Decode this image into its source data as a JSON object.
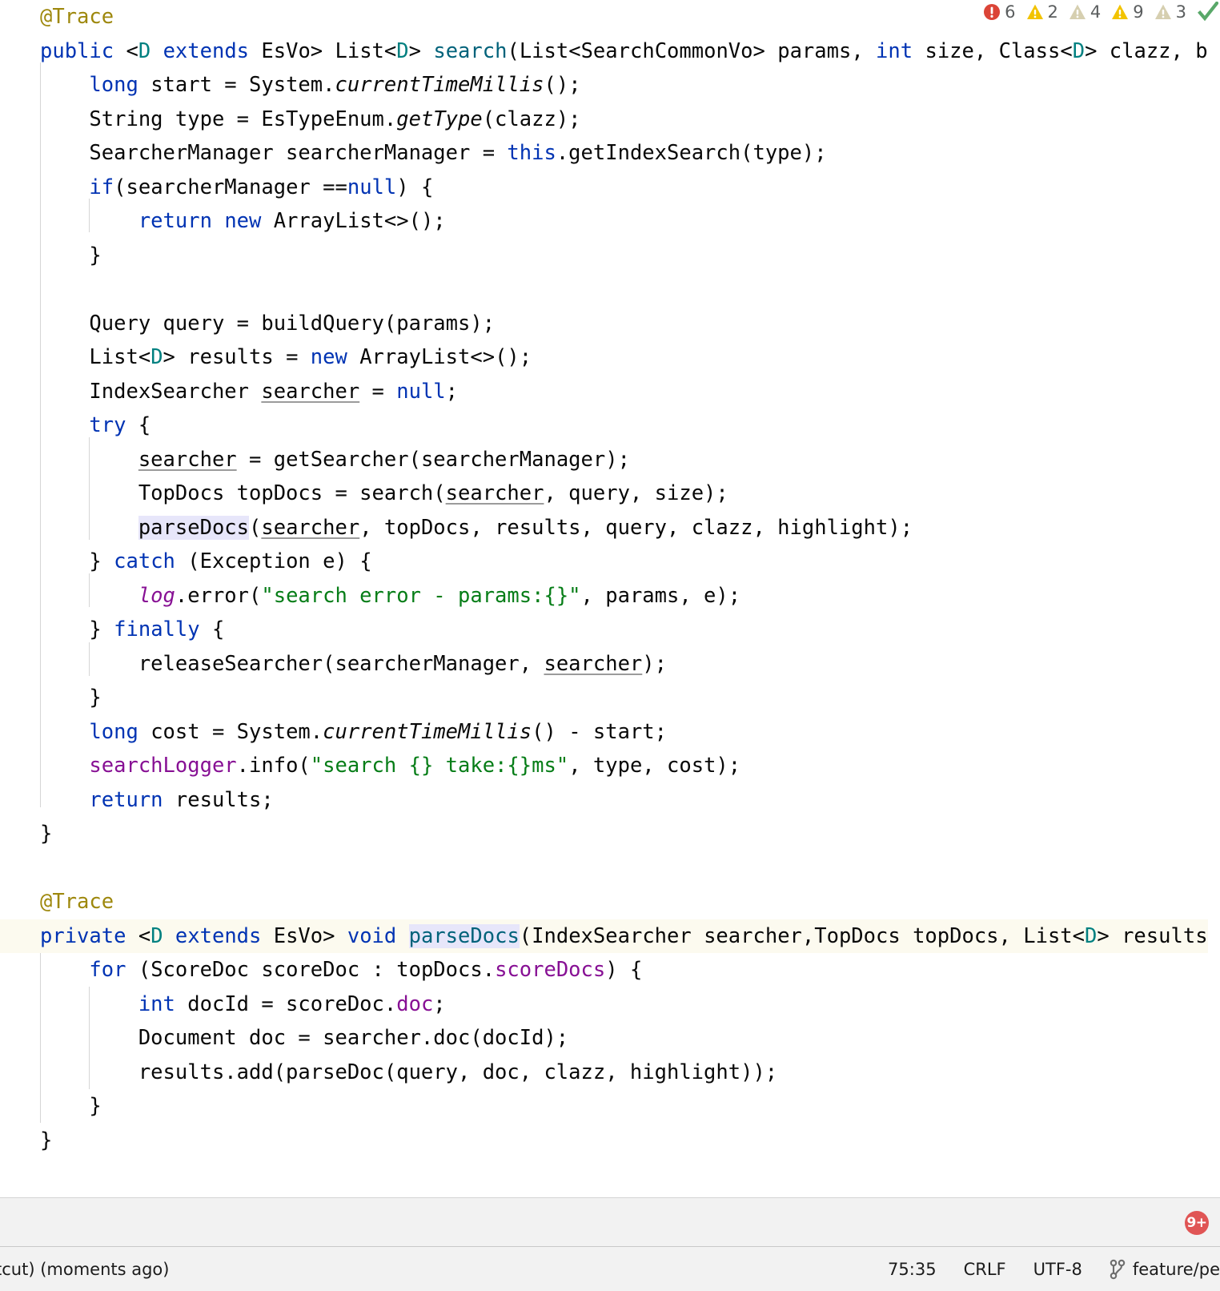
{
  "app": {
    "kind": "java-code-editor"
  },
  "inspection_widget": {
    "items": [
      {
        "icon": "error-icon",
        "count": "6",
        "severity": "error"
      },
      {
        "icon": "warning-icon",
        "count": "2",
        "severity": "warning"
      },
      {
        "icon": "weak-warning-icon",
        "count": "4",
        "severity": "weak-warning"
      },
      {
        "icon": "warning-icon",
        "count": "9",
        "severity": "warning"
      },
      {
        "icon": "weak-warning-icon",
        "count": "3",
        "severity": "weak-warning"
      }
    ],
    "status_icon": "inspection-ok-checkmark-icon"
  },
  "editor": {
    "lines": [
      {
        "id": "l1",
        "indent": 0,
        "caret": false,
        "tokens": [
          {
            "t": "@Trace",
            "c": "anno"
          }
        ]
      },
      {
        "id": "l2",
        "indent": 0,
        "caret": false,
        "tokens": [
          {
            "t": "public",
            "c": "kw"
          },
          {
            "t": " <",
            "c": ""
          },
          {
            "t": "D",
            "c": "tparam"
          },
          {
            "t": " ",
            "c": ""
          },
          {
            "t": "extends",
            "c": "kw"
          },
          {
            "t": " EsVo> List<",
            "c": ""
          },
          {
            "t": "D",
            "c": "tparam"
          },
          {
            "t": "> ",
            "c": ""
          },
          {
            "t": "search",
            "c": "mth"
          },
          {
            "t": "(List<SearchCommonVo> params, ",
            "c": ""
          },
          {
            "t": "int",
            "c": "kw"
          },
          {
            "t": " size, Class<",
            "c": ""
          },
          {
            "t": "D",
            "c": "tparam"
          },
          {
            "t": "> clazz, b",
            "c": ""
          }
        ]
      },
      {
        "id": "l3",
        "indent": 1,
        "caret": false,
        "tokens": [
          {
            "t": "long",
            "c": "kw"
          },
          {
            "t": " start = System.",
            "c": ""
          },
          {
            "t": "currentTimeMillis",
            "c": "stat"
          },
          {
            "t": "();",
            "c": ""
          }
        ]
      },
      {
        "id": "l4",
        "indent": 1,
        "caret": false,
        "tokens": [
          {
            "t": "String type = EsTypeEnum.",
            "c": ""
          },
          {
            "t": "getType",
            "c": "stat"
          },
          {
            "t": "(clazz);",
            "c": ""
          }
        ]
      },
      {
        "id": "l5",
        "indent": 1,
        "caret": false,
        "tokens": [
          {
            "t": "SearcherManager searcherManager = ",
            "c": ""
          },
          {
            "t": "this",
            "c": "kw"
          },
          {
            "t": ".getIndexSearch(type);",
            "c": ""
          }
        ]
      },
      {
        "id": "l6",
        "indent": 1,
        "caret": false,
        "tokens": [
          {
            "t": "if",
            "c": "kw"
          },
          {
            "t": "(searcherManager ==",
            "c": ""
          },
          {
            "t": "null",
            "c": "kw"
          },
          {
            "t": ") {",
            "c": ""
          }
        ]
      },
      {
        "id": "l7",
        "indent": 2,
        "caret": false,
        "tokens": [
          {
            "t": "return",
            "c": "kw"
          },
          {
            "t": " ",
            "c": ""
          },
          {
            "t": "new",
            "c": "kw"
          },
          {
            "t": " ArrayList<>();",
            "c": ""
          }
        ]
      },
      {
        "id": "l8",
        "indent": 1,
        "caret": false,
        "tokens": [
          {
            "t": "}",
            "c": ""
          }
        ]
      },
      {
        "id": "l9",
        "indent": 0,
        "caret": false,
        "tokens": [
          {
            "t": "",
            "c": ""
          }
        ]
      },
      {
        "id": "l10",
        "indent": 1,
        "caret": false,
        "tokens": [
          {
            "t": "Query query = buildQuery(params);",
            "c": ""
          }
        ]
      },
      {
        "id": "l11",
        "indent": 1,
        "caret": false,
        "tokens": [
          {
            "t": "List<",
            "c": ""
          },
          {
            "t": "D",
            "c": "tparam"
          },
          {
            "t": "> results = ",
            "c": ""
          },
          {
            "t": "new",
            "c": "kw"
          },
          {
            "t": " ArrayList<>();",
            "c": ""
          }
        ]
      },
      {
        "id": "l12",
        "indent": 1,
        "caret": false,
        "tokens": [
          {
            "t": "IndexSearcher ",
            "c": ""
          },
          {
            "t": "searcher",
            "c": "var-u"
          },
          {
            "t": " = ",
            "c": ""
          },
          {
            "t": "null",
            "c": "kw"
          },
          {
            "t": ";",
            "c": ""
          }
        ]
      },
      {
        "id": "l13",
        "indent": 1,
        "caret": false,
        "tokens": [
          {
            "t": "try",
            "c": "kw"
          },
          {
            "t": " {",
            "c": ""
          }
        ]
      },
      {
        "id": "l14",
        "indent": 2,
        "caret": false,
        "tokens": [
          {
            "t": "searcher",
            "c": "var-u"
          },
          {
            "t": " = getSearcher(searcherManager);",
            "c": ""
          }
        ]
      },
      {
        "id": "l15",
        "indent": 2,
        "caret": false,
        "tokens": [
          {
            "t": "TopDocs topDocs = search(",
            "c": ""
          },
          {
            "t": "searcher",
            "c": "var-u"
          },
          {
            "t": ", query, size);",
            "c": ""
          }
        ]
      },
      {
        "id": "l16",
        "indent": 2,
        "caret": false,
        "tokens": [
          {
            "t": "parseDocs",
            "c": "ident-hl"
          },
          {
            "t": "(",
            "c": ""
          },
          {
            "t": "searcher",
            "c": "var-u"
          },
          {
            "t": ", topDocs, results, query, clazz, highlight);",
            "c": ""
          }
        ]
      },
      {
        "id": "l17",
        "indent": 1,
        "caret": false,
        "tokens": [
          {
            "t": "} ",
            "c": ""
          },
          {
            "t": "catch",
            "c": "kw"
          },
          {
            "t": " (Exception e) {",
            "c": ""
          }
        ]
      },
      {
        "id": "l18",
        "indent": 2,
        "caret": false,
        "tokens": [
          {
            "t": "log",
            "c": "fld-i"
          },
          {
            "t": ".error(",
            "c": ""
          },
          {
            "t": "\"search error - params:{}\"",
            "c": "str"
          },
          {
            "t": ", params, e);",
            "c": ""
          }
        ]
      },
      {
        "id": "l19",
        "indent": 1,
        "caret": false,
        "tokens": [
          {
            "t": "} ",
            "c": ""
          },
          {
            "t": "finally",
            "c": "kw"
          },
          {
            "t": " {",
            "c": ""
          }
        ]
      },
      {
        "id": "l20",
        "indent": 2,
        "caret": false,
        "tokens": [
          {
            "t": "releaseSearcher(searcherManager, ",
            "c": ""
          },
          {
            "t": "searcher",
            "c": "var-u"
          },
          {
            "t": ");",
            "c": ""
          }
        ]
      },
      {
        "id": "l21",
        "indent": 1,
        "caret": false,
        "tokens": [
          {
            "t": "}",
            "c": ""
          }
        ]
      },
      {
        "id": "l22",
        "indent": 1,
        "caret": false,
        "tokens": [
          {
            "t": "long",
            "c": "kw"
          },
          {
            "t": " cost = System.",
            "c": ""
          },
          {
            "t": "currentTimeMillis",
            "c": "stat"
          },
          {
            "t": "() - start;",
            "c": ""
          }
        ]
      },
      {
        "id": "l23",
        "indent": 1,
        "caret": false,
        "tokens": [
          {
            "t": "searchLogger",
            "c": "fld"
          },
          {
            "t": ".info(",
            "c": ""
          },
          {
            "t": "\"search {} take:{}ms\"",
            "c": "str"
          },
          {
            "t": ", type, cost);",
            "c": ""
          }
        ]
      },
      {
        "id": "l24",
        "indent": 1,
        "caret": false,
        "tokens": [
          {
            "t": "return",
            "c": "kw"
          },
          {
            "t": " results;",
            "c": ""
          }
        ]
      },
      {
        "id": "l25",
        "indent": 0,
        "caret": false,
        "tokens": [
          {
            "t": "}",
            "c": ""
          }
        ]
      },
      {
        "id": "l26",
        "indent": 0,
        "caret": false,
        "tokens": [
          {
            "t": "",
            "c": ""
          }
        ]
      },
      {
        "id": "l27",
        "indent": 0,
        "caret": false,
        "tokens": [
          {
            "t": "@Trace",
            "c": "anno"
          }
        ]
      },
      {
        "id": "l28",
        "indent": 0,
        "caret": true,
        "tokens": [
          {
            "t": "private",
            "c": "kw"
          },
          {
            "t": " <",
            "c": ""
          },
          {
            "t": "D",
            "c": "tparam"
          },
          {
            "t": " ",
            "c": ""
          },
          {
            "t": "extends",
            "c": "kw"
          },
          {
            "t": " EsVo> ",
            "c": ""
          },
          {
            "t": "void",
            "c": "kw"
          },
          {
            "t": " ",
            "c": ""
          },
          {
            "t": "parseDocs",
            "c": "mth ident-hl"
          },
          {
            "t": "(IndexSearcher searcher,TopDocs topDocs, List<",
            "c": ""
          },
          {
            "t": "D",
            "c": "tparam"
          },
          {
            "t": "> results",
            "c": ""
          }
        ]
      },
      {
        "id": "l29",
        "indent": 1,
        "caret": false,
        "tokens": [
          {
            "t": "for",
            "c": "kw"
          },
          {
            "t": " (ScoreDoc scoreDoc : topDocs.",
            "c": ""
          },
          {
            "t": "scoreDocs",
            "c": "fld"
          },
          {
            "t": ") {",
            "c": ""
          }
        ]
      },
      {
        "id": "l30",
        "indent": 2,
        "caret": false,
        "tokens": [
          {
            "t": "int",
            "c": "kw"
          },
          {
            "t": " docId = scoreDoc.",
            "c": ""
          },
          {
            "t": "doc",
            "c": "fld"
          },
          {
            "t": ";",
            "c": ""
          }
        ]
      },
      {
        "id": "l31",
        "indent": 2,
        "caret": false,
        "tokens": [
          {
            "t": "Document doc = searcher.doc(docId);",
            "c": ""
          }
        ]
      },
      {
        "id": "l32",
        "indent": 2,
        "caret": false,
        "tokens": [
          {
            "t": "results.add(parseDoc(query, doc, clazz, highlight));",
            "c": ""
          }
        ]
      },
      {
        "id": "l33",
        "indent": 1,
        "caret": false,
        "tokens": [
          {
            "t": "}",
            "c": ""
          }
        ]
      },
      {
        "id": "l34",
        "indent": 0,
        "caret": false,
        "tokens": [
          {
            "t": "}",
            "c": ""
          }
        ]
      }
    ]
  },
  "bottom_panel": {
    "notification_badge": "9+"
  },
  "status_bar": {
    "left_text": "tcut) (moments ago)",
    "caret_position": "75:35",
    "line_separator": "CRLF",
    "encoding": "UTF-8",
    "branch": "feature/pe",
    "branch_icon": "git-branch-icon"
  },
  "colors": {
    "keyword": "#0033b3",
    "type_param": "#008080",
    "method": "#00627a",
    "string": "#067d17",
    "field": "#871094",
    "annotation": "#9e880d",
    "caret_line": "#fcfaef",
    "identifier_highlight": "#e7e6fa",
    "error_red": "#db4437",
    "warning_yellow": "#f2c300",
    "weak_warning": "#d6cfb0",
    "badge_red": "#e05555",
    "status_bg": "#f2f2f2"
  }
}
